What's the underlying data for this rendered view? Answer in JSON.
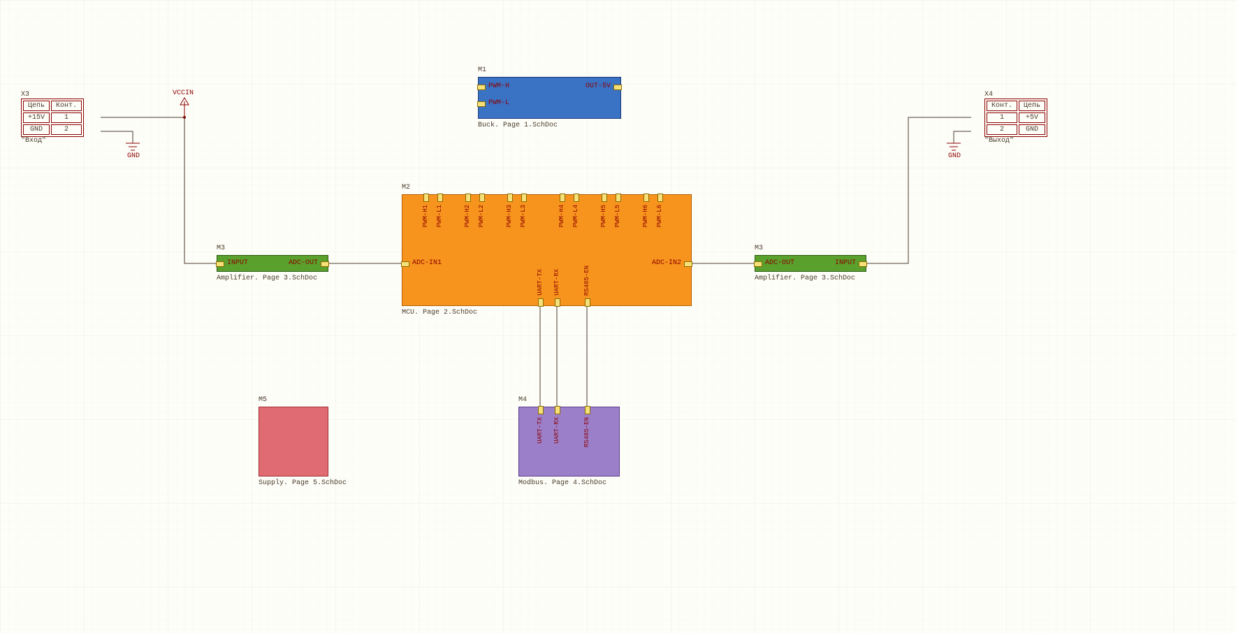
{
  "connectors": {
    "x3": {
      "designator": "X3",
      "header_chain": "Цепь",
      "header_cont": "Конт.",
      "rows": [
        {
          "chain": "+15V",
          "cont": "1"
        },
        {
          "chain": "GND",
          "cont": "2"
        }
      ],
      "footer": "\"Вход\""
    },
    "x4": {
      "designator": "X4",
      "header_chain": "Цепь",
      "header_cont": "Конт.",
      "rows": [
        {
          "cont": "1",
          "chain": "+5V"
        },
        {
          "cont": "2",
          "chain": "GND"
        }
      ],
      "footer": "\"Выход\""
    }
  },
  "power": {
    "vccin": "VCCIN",
    "gnd": "GND"
  },
  "sheets": {
    "m1": {
      "designator": "M1",
      "caption": "Buck. Page 1.SchDoc",
      "ports_left": [
        "PWM-H",
        "PWM-L"
      ],
      "ports_right": [
        "OUT-5V"
      ]
    },
    "m2": {
      "designator": "M2",
      "caption": "MCU. Page 2.SchDoc",
      "ports_top": [
        "PWM-H1",
        "PWM-L1",
        "PWM-H2",
        "PWM-L2",
        "PWM-H3",
        "PWM-L3",
        "PWM-H4",
        "PWM-L4",
        "PWM-H5",
        "PWM-L5",
        "PWM-H6",
        "PWM-L6"
      ],
      "ports_left": [
        "ADC-IN1"
      ],
      "ports_right": [
        "ADC-IN2"
      ],
      "ports_bottom": [
        "UART-TX",
        "UART-RX",
        "RS485-EN"
      ]
    },
    "m3a": {
      "designator": "M3",
      "caption": "Amplifier. Page 3.SchDoc",
      "port_left": "INPUT",
      "port_right": "ADC-OUT"
    },
    "m3b": {
      "designator": "M3",
      "caption": "Amplifier. Page 3.SchDoc",
      "port_left": "ADC-OUT",
      "port_right": "INPUT"
    },
    "m4": {
      "designator": "M4",
      "caption": "Modbus. Page 4.SchDoc",
      "ports_top": [
        "UART-TX",
        "UART-RX",
        "RS485-EN"
      ]
    },
    "m5": {
      "designator": "M5",
      "caption": "Supply. Page 5.SchDoc"
    }
  }
}
